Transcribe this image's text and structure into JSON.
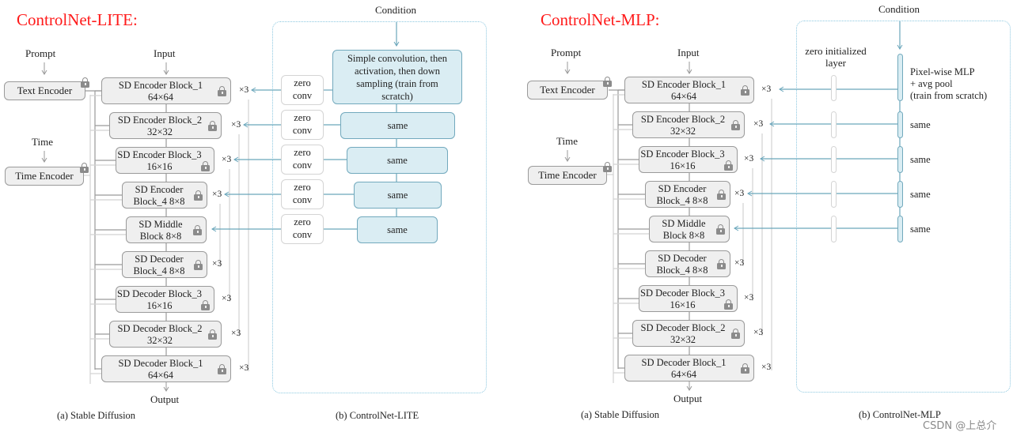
{
  "left": {
    "title": "ControlNet-LITE:",
    "prompt_label": "Prompt",
    "input_label": "Input",
    "time_label": "Time",
    "output_label": "Output",
    "condition_label": "Condition",
    "text_encoder": "Text Encoder",
    "time_encoder": "Time Encoder",
    "sd_blocks": [
      {
        "line1": "SD Encoder Block_1",
        "line2": "64×64",
        "mult": "×3"
      },
      {
        "line1": "SD Encoder Block_2",
        "line2": "32×32",
        "mult": "×3"
      },
      {
        "line1": "SD Encoder Block_3",
        "line2": "16×16",
        "mult": "×3"
      },
      {
        "line1": "SD Encoder",
        "line2": "Block_4 8×8",
        "mult": "×3"
      },
      {
        "line1": "SD Middle",
        "line2": "Block 8×8",
        "mult": ""
      },
      {
        "line1": "SD Decoder",
        "line2": "Block_4 8×8",
        "mult": "×3"
      },
      {
        "line1": "SD Decoder Block_3",
        "line2": "16×16",
        "mult": "×3"
      },
      {
        "line1": "SD Decoder Block_2",
        "line2": "32×32",
        "mult": "×3"
      },
      {
        "line1": "SD Decoder Block_1",
        "line2": "64×64",
        "mult": "×3"
      }
    ],
    "zero_conv": {
      "line1": "zero",
      "line2": "conv"
    },
    "control_blocks": [
      "Simple convolution, then activation, then down sampling (train from scratch)",
      "same",
      "same",
      "same",
      "same"
    ],
    "caption_a": "(a) Stable Diffusion",
    "caption_b": "(b) ControlNet-LITE"
  },
  "right": {
    "title": "ControlNet-MLP:",
    "prompt_label": "Prompt",
    "input_label": "Input",
    "time_label": "Time",
    "output_label": "Output",
    "condition_label": "Condition",
    "text_encoder": "Text Encoder",
    "time_encoder": "Time Encoder",
    "zero_layer_label": "zero initialized layer",
    "sd_blocks": [
      {
        "line1": "SD Encoder Block_1",
        "line2": "64×64",
        "mult": "×3"
      },
      {
        "line1": "SD Encoder Block_2",
        "line2": "32×32",
        "mult": "×3"
      },
      {
        "line1": "SD Encoder Block_3",
        "line2": "16×16",
        "mult": "×3"
      },
      {
        "line1": "SD Encoder",
        "line2": "Block_4 8×8",
        "mult": "×3"
      },
      {
        "line1": "SD Middle",
        "line2": "Block 8×8",
        "mult": ""
      },
      {
        "line1": "SD Decoder",
        "line2": "Block_4 8×8",
        "mult": "×3"
      },
      {
        "line1": "SD Decoder Block_3",
        "line2": "16×16",
        "mult": "×3"
      },
      {
        "line1": "SD Decoder Block_2",
        "line2": "32×32",
        "mult": "×3"
      },
      {
        "line1": "SD Decoder Block_1",
        "line2": "64×64",
        "mult": "×3"
      }
    ],
    "mlp_labels": [
      "Pixel-wise MLP + avg pool (train from scratch)",
      "same",
      "same",
      "same",
      "same"
    ],
    "mlp_first_lines": [
      "Pixel-wise MLP",
      "+ avg pool",
      "(train from scratch)"
    ],
    "caption_a": "(a) Stable Diffusion",
    "caption_b": "(b) ControlNet-MLP"
  },
  "watermark": "CSDN @上总介",
  "colors": {
    "title": "#ff1a1a",
    "control_fill": "#daedf3",
    "control_stroke": "#72a9bd",
    "sd_fill": "#efefef",
    "sd_stroke": "#9a9a9a",
    "panel_border": "#8cc8e0"
  }
}
